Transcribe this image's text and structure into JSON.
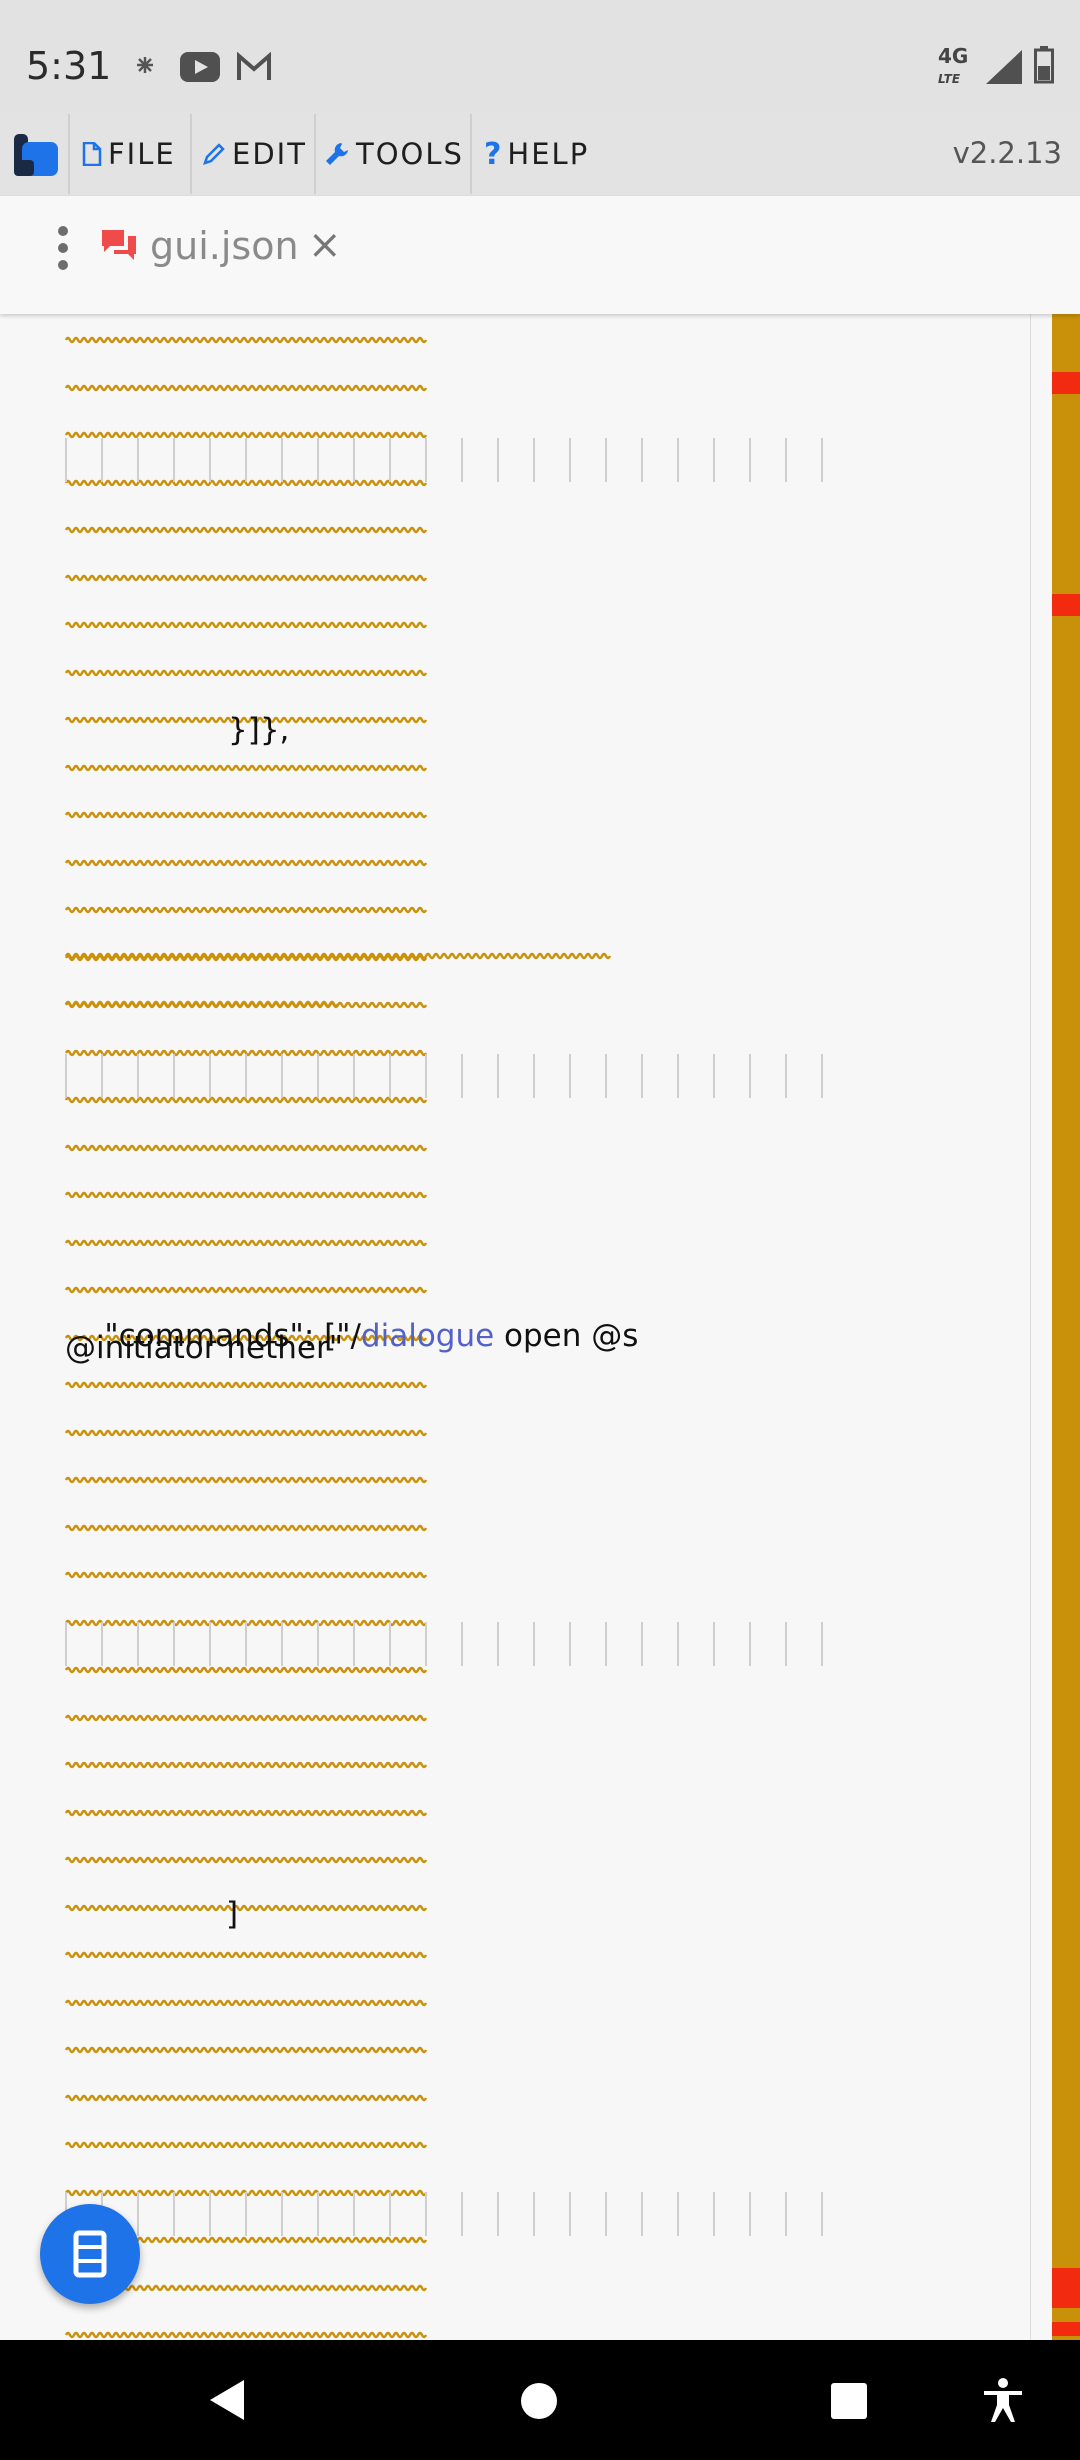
{
  "status_bar": {
    "time": "5:31",
    "icons": [
      "fan-icon",
      "youtube-icon",
      "gmail-icon",
      "lte-4g-icon",
      "signal-icon",
      "battery-icon"
    ],
    "network_label": "4G"
  },
  "menu": {
    "items": [
      {
        "label": "FILE",
        "icon": "file-icon"
      },
      {
        "label": "EDIT",
        "icon": "pencil-icon"
      },
      {
        "label": "TOOLS",
        "icon": "wrench-icon"
      },
      {
        "label": "HELP",
        "icon": "question-icon"
      }
    ],
    "version": "v2.2.13"
  },
  "tab": {
    "title": "gui.json",
    "icon": "comments-icon",
    "close": "×"
  },
  "editor": {
    "lines": [
      {
        "text": "}]},"
      },
      {
        "text_prefix": "\"commands\": [\"/",
        "keyword": "dialogue",
        "text_suffix": " open @s"
      },
      {
        "text": "@initiator nether\""
      },
      {
        "text": "]"
      },
      {
        "text": "},"
      }
    ]
  },
  "colors": {
    "accent": "#1e73e8",
    "squiggle": "#c9910a",
    "scroll_marker": "#f22a10",
    "keyword": "#5461c8"
  }
}
